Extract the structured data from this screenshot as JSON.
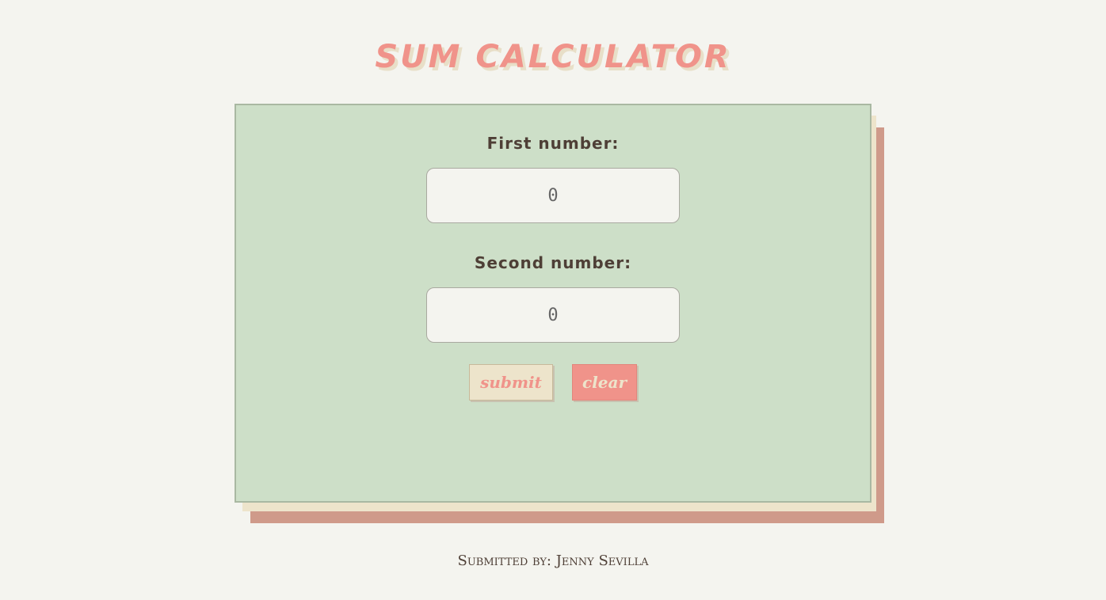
{
  "header": {
    "title": "SUM CALCULATOR"
  },
  "form": {
    "first_label": "First number:",
    "first_value": "0",
    "second_label": "Second number:",
    "second_value": "0",
    "submit_label": "submit",
    "clear_label": "clear"
  },
  "footer": {
    "text": "Submitted by: Jenny Sevilla"
  },
  "colors": {
    "background": "#f4f4ef",
    "card": "#cddfc8",
    "accent": "#f0938a",
    "cream": "#ede4cb",
    "shadow_layer": "#cf9a8a",
    "text": "#4e3f36"
  }
}
